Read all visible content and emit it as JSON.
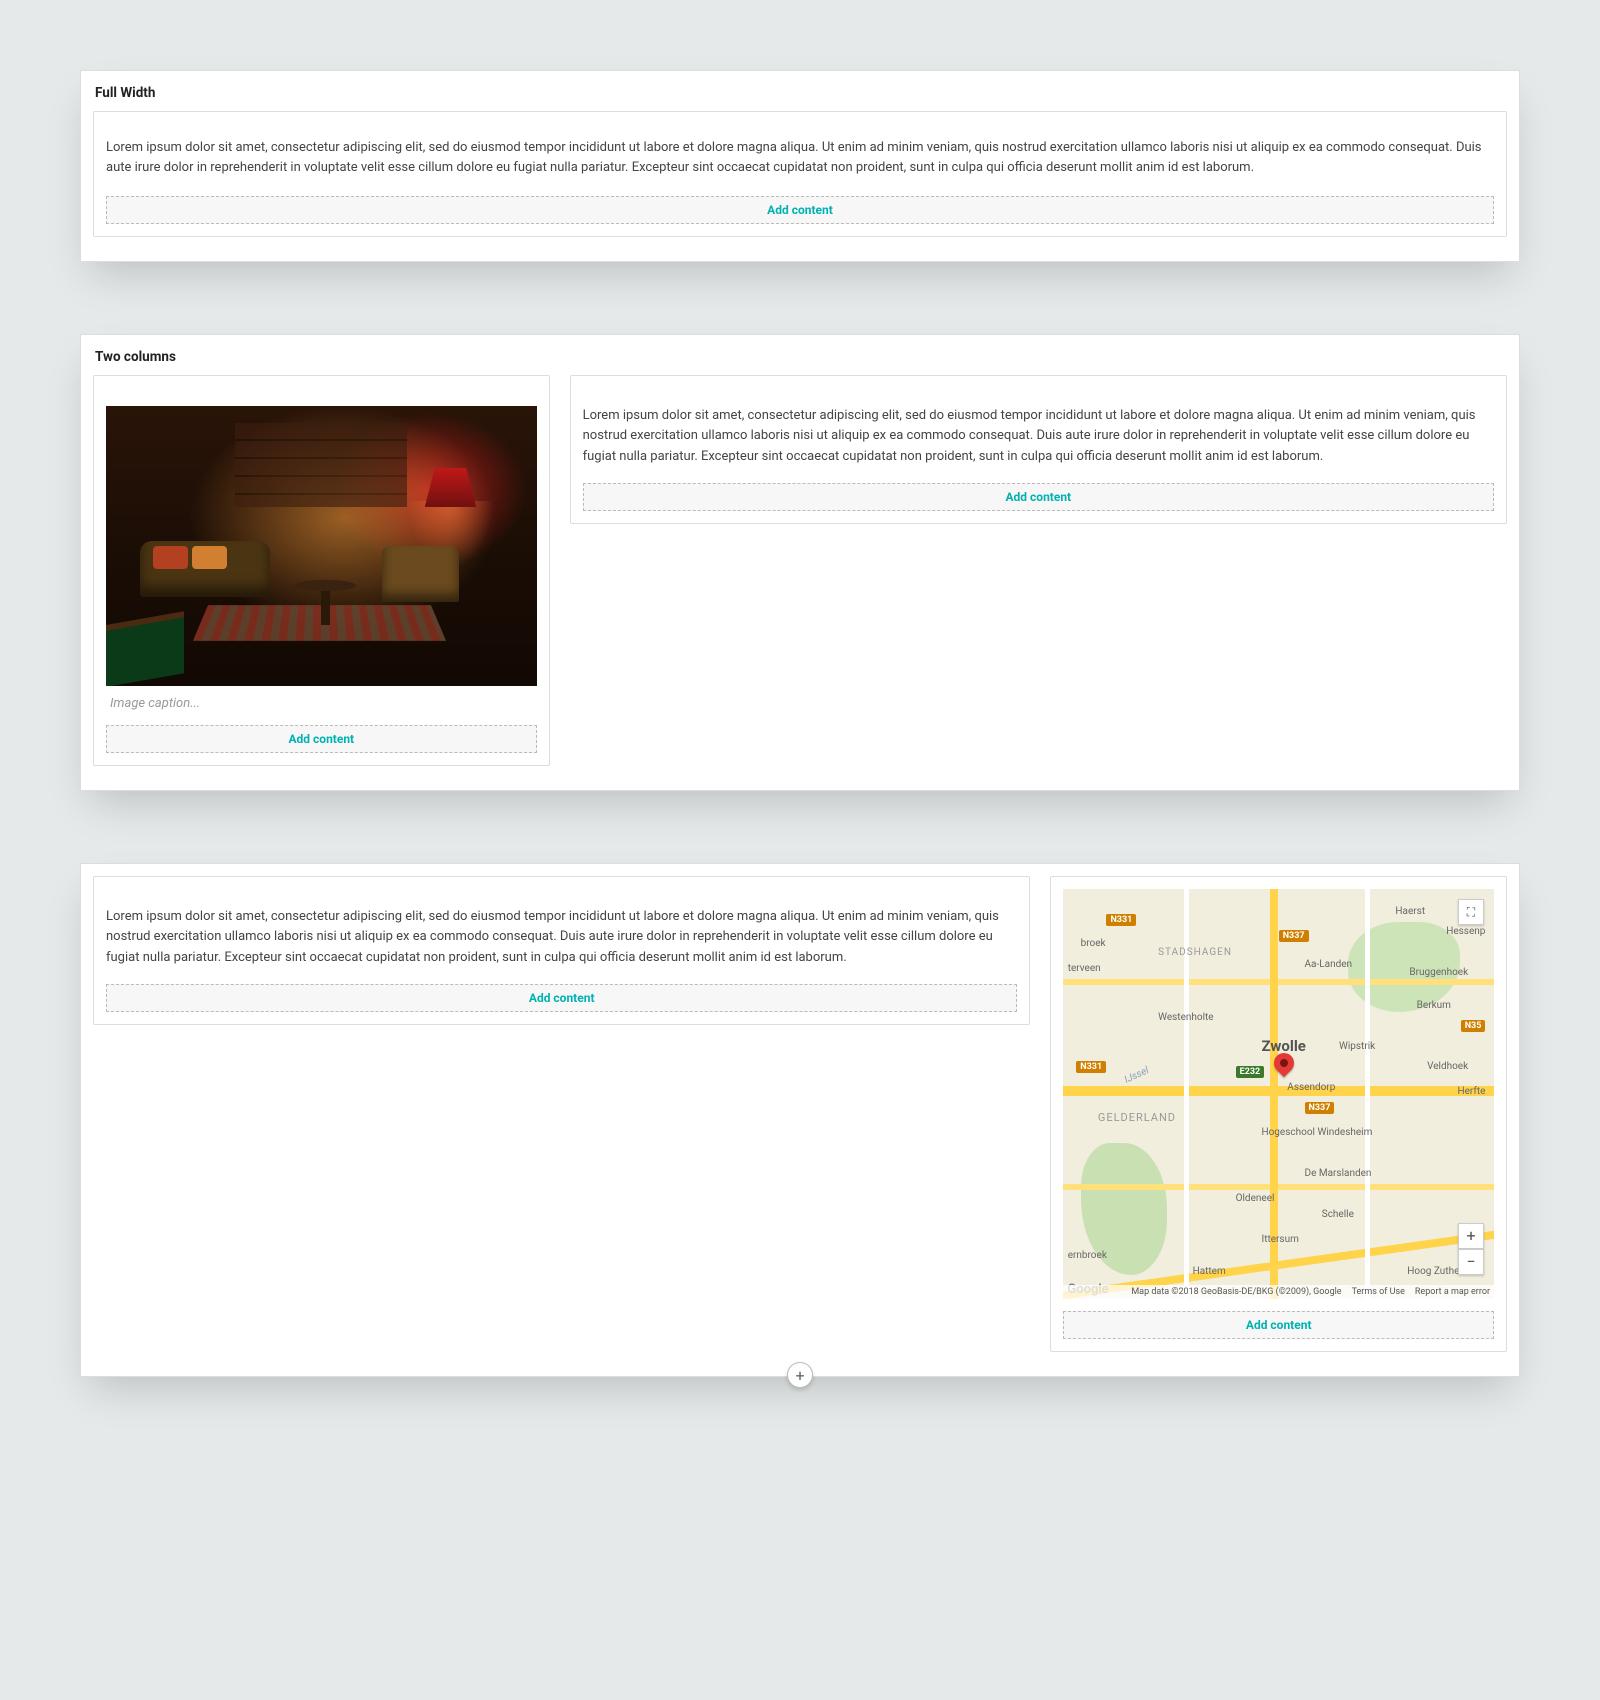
{
  "common": {
    "add_content": "Add content",
    "lorem": "Lorem ipsum dolor sit amet, consectetur adipiscing elit, sed do eiusmod tempor incididunt ut labore et dolore magna aliqua. Ut enim ad minim veniam, quis nostrud exercitation ullamco laboris nisi ut aliquip ex ea commodo consequat. Duis aute irure dolor in reprehenderit in voluptate velit esse cillum dolore eu fugiat nulla pariatur. Excepteur sint occaecat cupidatat non proident, sunt in culpa qui officia deserunt mollit anim id est laborum."
  },
  "section1": {
    "title": "Full Width"
  },
  "section2": {
    "title": "Two columns",
    "image_caption_placeholder": "Image caption..."
  },
  "section3": {
    "map": {
      "city": "Zwolle",
      "region": "GELDERLAND",
      "labels": [
        "Haerst",
        "Hessenp",
        "Aa-Landen",
        "Bruggenhoek",
        "Berkum",
        "Westenholte",
        "Wipstrik",
        "Veldhoek",
        "Herfte",
        "Assendorp",
        "Hogeschool Windesheim",
        "De Marslanden",
        "Schelle",
        "Ittersum",
        "Hattem",
        "Hoog Zuthem",
        "Oldeneel",
        "STADSHAGEN",
        "broek",
        "terveen",
        "IJssel",
        "ernbroek"
      ],
      "badges": [
        "N331",
        "N337",
        "E232",
        "N331",
        "N337",
        "N35"
      ],
      "google": "Google",
      "attr_data": "Map data ©2018 GeoBasis-DE/BKG (©2009), Google",
      "attr_terms": "Terms of Use",
      "attr_report": "Report a map error",
      "zoom_in": "+",
      "zoom_out": "−",
      "fullscreen": "⛶"
    }
  },
  "fab": {
    "label": "+"
  }
}
